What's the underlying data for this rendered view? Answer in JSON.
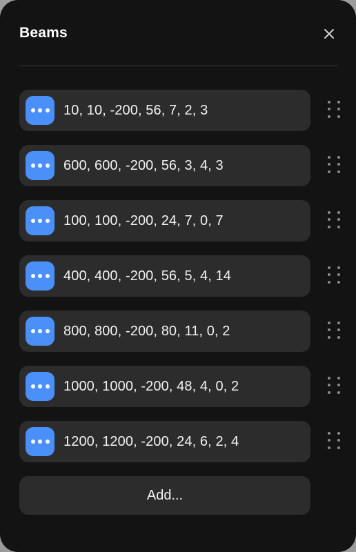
{
  "panel": {
    "title": "Beams",
    "close_icon": "close-icon",
    "accent_color": "#4a90f8",
    "row_background": "#2c2c2c",
    "panel_background": "#131313",
    "text_color": "#f2f2f2"
  },
  "rows": [
    {
      "menu_icon": "ellipsis-icon",
      "value": "10, 10, -200, 56, 7, 2, 3",
      "drag_icon": "drag-handle-icon"
    },
    {
      "menu_icon": "ellipsis-icon",
      "value": "600, 600, -200, 56, 3, 4, 3",
      "drag_icon": "drag-handle-icon"
    },
    {
      "menu_icon": "ellipsis-icon",
      "value": "100, 100, -200, 24, 7, 0, 7",
      "drag_icon": "drag-handle-icon"
    },
    {
      "menu_icon": "ellipsis-icon",
      "value": "400, 400, -200, 56, 5, 4, 14",
      "drag_icon": "drag-handle-icon"
    },
    {
      "menu_icon": "ellipsis-icon",
      "value": "800, 800, -200, 80, 11, 0, 2",
      "drag_icon": "drag-handle-icon"
    },
    {
      "menu_icon": "ellipsis-icon",
      "value": "1000, 1000, -200, 48, 4, 0, 2",
      "drag_icon": "drag-handle-icon"
    },
    {
      "menu_icon": "ellipsis-icon",
      "value": "1200, 1200, -200, 24, 6, 2, 4",
      "drag_icon": "drag-handle-icon"
    }
  ],
  "add": {
    "label": "Add..."
  }
}
